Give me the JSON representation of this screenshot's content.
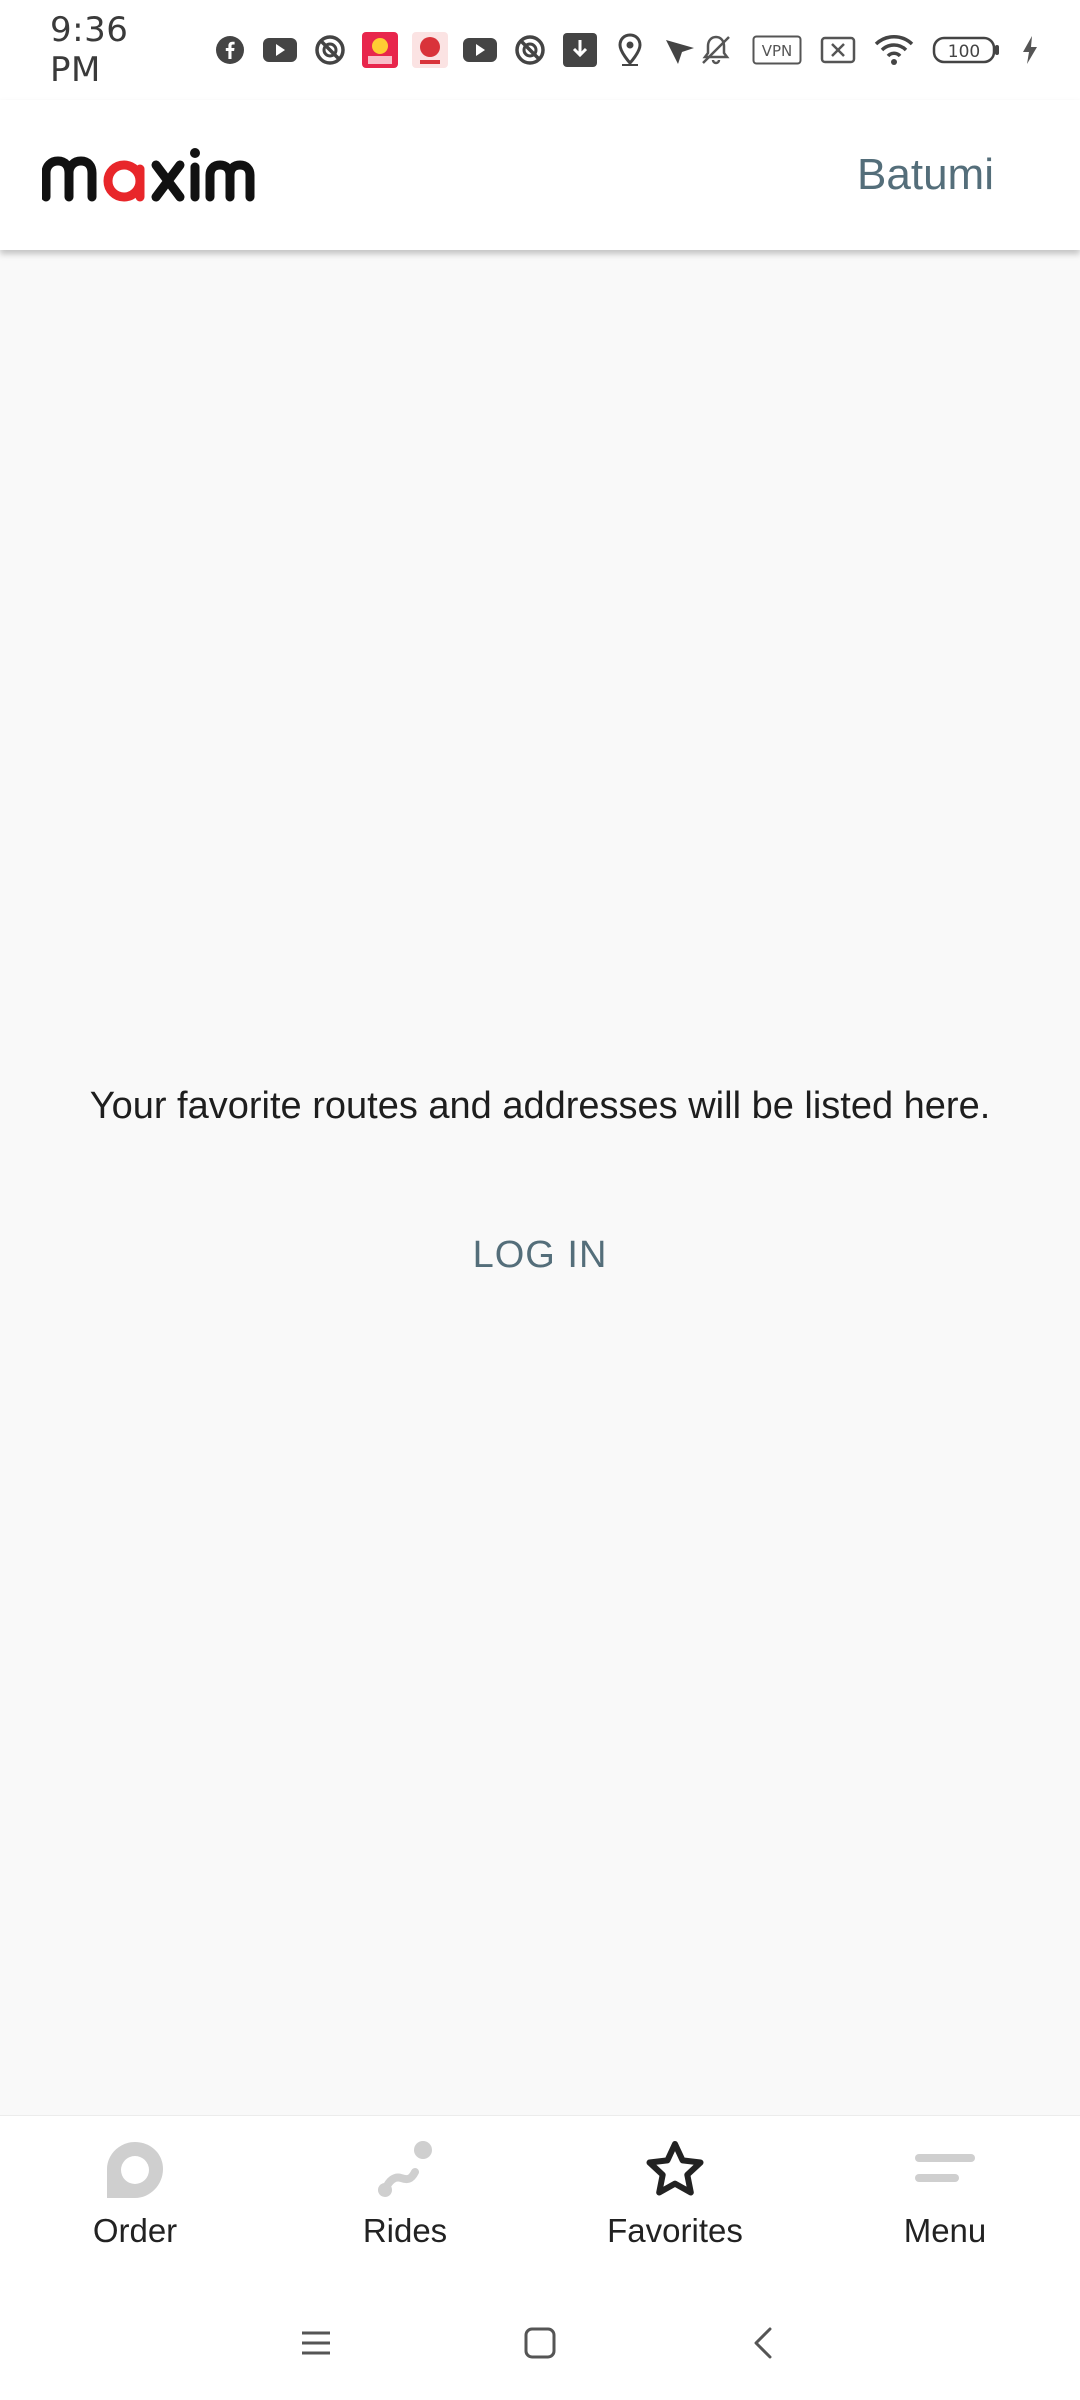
{
  "status_bar": {
    "time": "9:36 PM",
    "battery": "100",
    "vpn": "VPN",
    "left_icons": [
      "facebook-icon",
      "youtube-icon",
      "blocked-app-icon",
      "game-app-icon",
      "chinese-app-icon",
      "youtube-icon",
      "blocked-app-icon",
      "download-icon",
      "location-icon",
      "navigation-icon"
    ],
    "right_icons": [
      "mute-icon",
      "vpn-icon",
      "no-sim-icon",
      "wifi-icon",
      "battery-icon",
      "charging-icon"
    ]
  },
  "header": {
    "logo": "maxim",
    "city": "Batumi",
    "colors": {
      "logo_accent": "#e8262a",
      "city_text": "#546e7a"
    }
  },
  "main": {
    "empty_message": "Your favorite routes and addresses will be listed here.",
    "login_label": "LOG IN"
  },
  "bottom_nav": {
    "items": [
      {
        "label": "Order",
        "icon": "order-icon",
        "active": false
      },
      {
        "label": "Rides",
        "icon": "rides-icon",
        "active": false
      },
      {
        "label": "Favorites",
        "icon": "star-icon",
        "active": true
      },
      {
        "label": "Menu",
        "icon": "menu-icon",
        "active": false
      }
    ]
  },
  "system_nav": {
    "buttons": [
      "recents-icon",
      "home-icon",
      "back-icon"
    ]
  }
}
